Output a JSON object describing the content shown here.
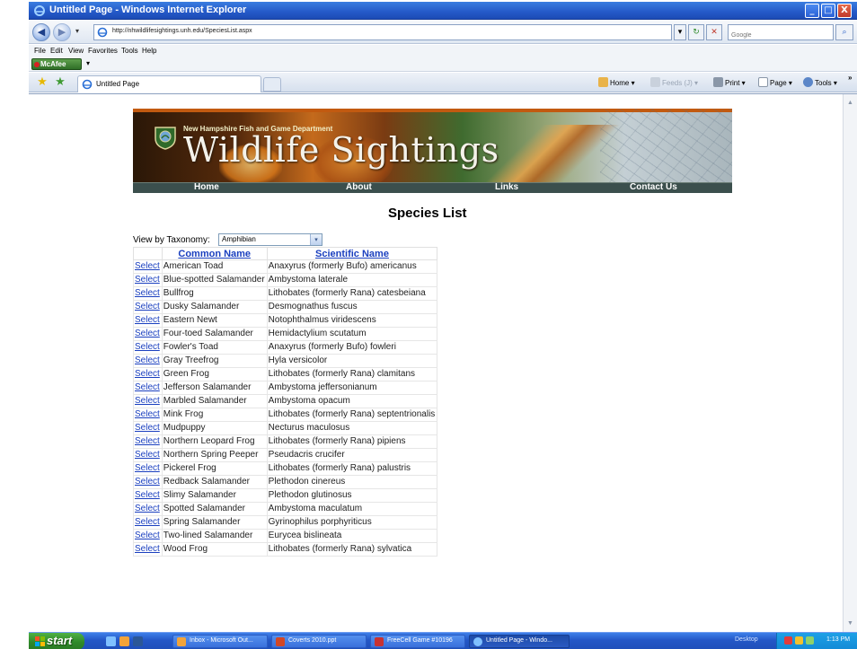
{
  "window": {
    "title": "Untitled Page - Windows Internet Explorer",
    "minimize_glyph": "_",
    "maximize_glyph": "□",
    "close_glyph": "X"
  },
  "address_bar": {
    "url": "http://nhwildlifesightings.unh.edu/SpeciesList.aspx",
    "search_placeholder": "Google",
    "refresh_glyph": "↻",
    "stop_glyph": "✕",
    "dropdown_glyph": "▾",
    "search_glyph": "⌕"
  },
  "menu": [
    "File",
    "Edit",
    "View",
    "Favorites",
    "Tools",
    "Help"
  ],
  "addon": {
    "label": "McAfee"
  },
  "tab": {
    "label": "Untitled Page"
  },
  "command_bar": {
    "home": "Home",
    "feeds": "Feeds (J)",
    "print": "Print",
    "page": "Page",
    "tools": "Tools",
    "more": "»"
  },
  "banner": {
    "department": "New Hampshire Fish and Game Department",
    "title": "Wildlife Sightings",
    "nav": [
      "Home",
      "About",
      "Links",
      "Contact Us"
    ]
  },
  "page": {
    "title": "Species List",
    "taxonomy_label": "View by Taxonomy:",
    "taxonomy_value": "Amphibian",
    "select_label": "Select",
    "columns": [
      "Common Name",
      "Scientific Name"
    ],
    "rows": [
      [
        "American Toad",
        "Anaxyrus (formerly Bufo) americanus"
      ],
      [
        "Blue-spotted Salamander",
        "Ambystoma laterale"
      ],
      [
        "Bullfrog",
        "Lithobates (formerly Rana) catesbeiana"
      ],
      [
        "Dusky Salamander",
        "Desmognathus fuscus"
      ],
      [
        "Eastern Newt",
        "Notophthalmus viridescens"
      ],
      [
        "Four-toed Salamander",
        "Hemidactylium scutatum"
      ],
      [
        "Fowler's Toad",
        "Anaxyrus (formerly Bufo) fowleri"
      ],
      [
        "Gray Treefrog",
        "Hyla versicolor"
      ],
      [
        "Green Frog",
        "Lithobates (formerly Rana) clamitans"
      ],
      [
        "Jefferson Salamander",
        "Ambystoma jeffersonianum"
      ],
      [
        "Marbled Salamander",
        "Ambystoma opacum"
      ],
      [
        "Mink Frog",
        "Lithobates (formerly Rana) septentrionalis"
      ],
      [
        "Mudpuppy",
        "Necturus maculosus"
      ],
      [
        "Northern Leopard Frog",
        "Lithobates (formerly Rana) pipiens"
      ],
      [
        "Northern Spring Peeper",
        "Pseudacris crucifer"
      ],
      [
        "Pickerel Frog",
        "Lithobates (formerly Rana) palustris"
      ],
      [
        "Redback Salamander",
        "Plethodon cinereus"
      ],
      [
        "Slimy Salamander",
        "Plethodon glutinosus"
      ],
      [
        "Spotted Salamander",
        "Ambystoma maculatum"
      ],
      [
        "Spring Salamander",
        "Gyrinophilus porphyriticus"
      ],
      [
        "Two-lined Salamander",
        "Eurycea bislineata"
      ],
      [
        "Wood Frog",
        "Lithobates (formerly Rana) sylvatica"
      ]
    ]
  },
  "taskbar": {
    "start": "start",
    "tasks": [
      "Inbox - Microsoft Out...",
      "Coverts 2010.ppt",
      "FreeCell Game #10196",
      "Untitled Page - Windo..."
    ],
    "desktop": "Desktop",
    "clock": "1:13 PM"
  },
  "colors": {
    "link": "#1a3fbf",
    "title_bar": "#2459c8",
    "banner_nav": "#3b4f4d",
    "taskbar": "#2457c7",
    "start_button": "#2f8a2a"
  }
}
